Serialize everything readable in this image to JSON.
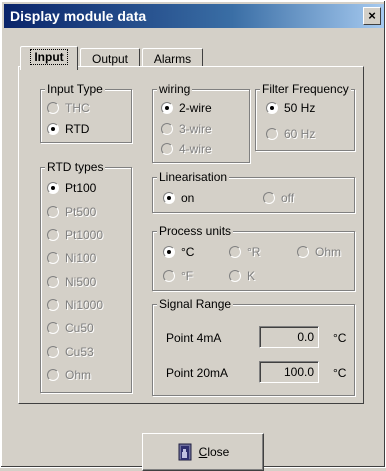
{
  "window": {
    "title": "Display module data",
    "close_glyph": "×"
  },
  "tabs": [
    {
      "label": "Input",
      "active": true
    },
    {
      "label": "Output",
      "active": false
    },
    {
      "label": "Alarms",
      "active": false
    }
  ],
  "input_type": {
    "legend": "Input Type",
    "options": [
      {
        "label": "THC",
        "checked": false,
        "enabled": false
      },
      {
        "label": "RTD",
        "checked": true,
        "enabled": true
      }
    ]
  },
  "rtd_types": {
    "legend": "RTD types",
    "options": [
      {
        "label": "Pt100",
        "checked": true,
        "enabled": true
      },
      {
        "label": "Pt500",
        "checked": false,
        "enabled": false
      },
      {
        "label": "Pt1000",
        "checked": false,
        "enabled": false
      },
      {
        "label": "Ni100",
        "checked": false,
        "enabled": false
      },
      {
        "label": "Ni500",
        "checked": false,
        "enabled": false
      },
      {
        "label": "Ni1000",
        "checked": false,
        "enabled": false
      },
      {
        "label": "Cu50",
        "checked": false,
        "enabled": false
      },
      {
        "label": "Cu53",
        "checked": false,
        "enabled": false
      },
      {
        "label": "Ohm",
        "checked": false,
        "enabled": false
      }
    ]
  },
  "wiring": {
    "legend": "wiring",
    "options": [
      {
        "label": "2-wire",
        "checked": true,
        "enabled": true
      },
      {
        "label": "3-wire",
        "checked": false,
        "enabled": false
      },
      {
        "label": "4-wire",
        "checked": false,
        "enabled": false
      }
    ]
  },
  "filter_frequency": {
    "legend": "Filter Frequency",
    "options": [
      {
        "label": "50 Hz",
        "checked": true,
        "enabled": true
      },
      {
        "label": "60 Hz",
        "checked": false,
        "enabled": false
      }
    ]
  },
  "linearisation": {
    "legend": "Linearisation",
    "options": [
      {
        "label": "on",
        "checked": true,
        "enabled": true
      },
      {
        "label": "off",
        "checked": false,
        "enabled": false
      }
    ]
  },
  "process_units": {
    "legend": "Process units",
    "options": [
      {
        "label": "°C",
        "checked": true,
        "enabled": true
      },
      {
        "label": "°R",
        "checked": false,
        "enabled": false
      },
      {
        "label": "Ohm",
        "checked": false,
        "enabled": false
      },
      {
        "label": "°F",
        "checked": false,
        "enabled": false
      },
      {
        "label": "K",
        "checked": false,
        "enabled": false
      }
    ]
  },
  "signal_range": {
    "legend": "Signal Range",
    "point_4ma": {
      "label": "Point 4mA",
      "value": "0.0",
      "unit": "°C"
    },
    "point_20ma": {
      "label": "Point 20mA",
      "value": "100.0",
      "unit": "°C"
    }
  },
  "close_button": {
    "label_underlined": "C",
    "label_rest": "lose",
    "icon": "exit-door-icon"
  }
}
